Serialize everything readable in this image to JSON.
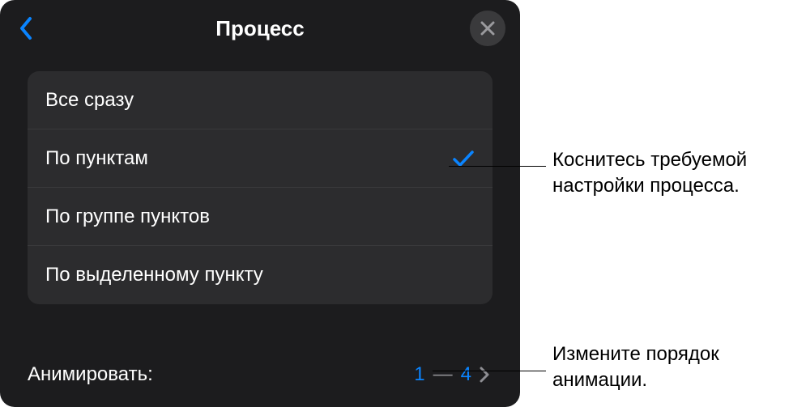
{
  "header": {
    "title": "Процесс"
  },
  "options": {
    "items": [
      {
        "label": "Все сразу",
        "selected": false
      },
      {
        "label": "По пунктам",
        "selected": true
      },
      {
        "label": "По группе пунктов",
        "selected": false
      },
      {
        "label": "По выделенному пункту",
        "selected": false
      }
    ]
  },
  "footer": {
    "label": "Анимировать:",
    "from": "1",
    "dash": "—",
    "to": "4"
  },
  "callouts": {
    "setting": "Коснитесь требуемой настройки процесса.",
    "order": "Измените порядок анимации."
  },
  "colors": {
    "accent": "#0a84ff"
  }
}
